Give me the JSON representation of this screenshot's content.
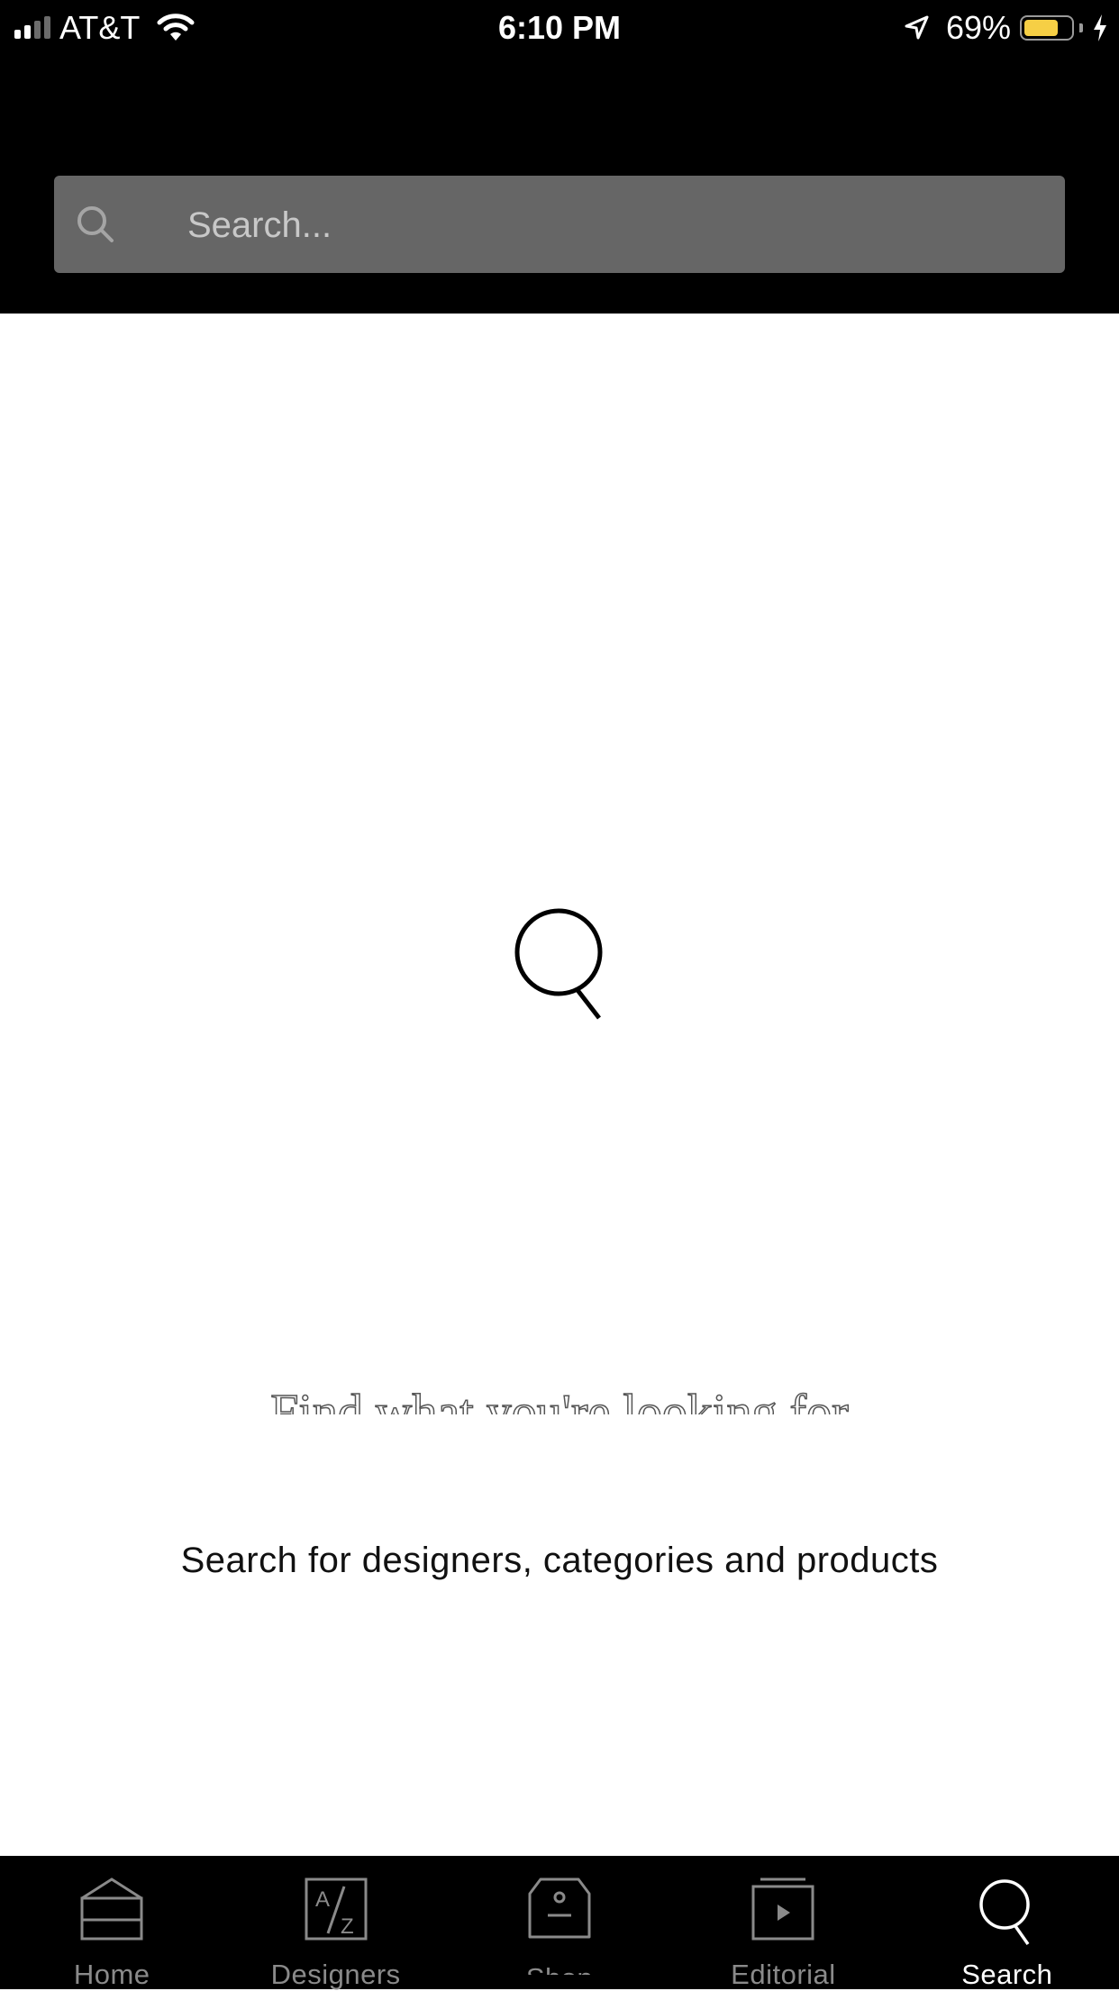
{
  "status_bar": {
    "carrier": "AT&T",
    "time": "6:10 PM",
    "battery_percent": "69%",
    "battery_level": 0.69,
    "battery_color": "#f6cf45"
  },
  "search": {
    "placeholder": "Search...",
    "value": ""
  },
  "empty_state": {
    "icon": "search-icon",
    "headline": "Find what you're looking for",
    "subtitle": "Search for designers, categories and products"
  },
  "tab_bar": {
    "tabs": [
      {
        "label": "Home",
        "icon": "home-icon",
        "active": false
      },
      {
        "label": "Designers",
        "icon": "a-z-icon",
        "active": false
      },
      {
        "label": "Shop",
        "icon": "shop-tag-icon",
        "active": false
      },
      {
        "label": "Editorial",
        "icon": "editorial-play-icon",
        "active": false
      },
      {
        "label": "Search",
        "icon": "search-icon",
        "active": true
      }
    ]
  },
  "colors": {
    "header_bg": "#000000",
    "search_box_bg": "#666666",
    "tab_inactive": "#8a8a8a",
    "tab_active": "#ffffff"
  }
}
